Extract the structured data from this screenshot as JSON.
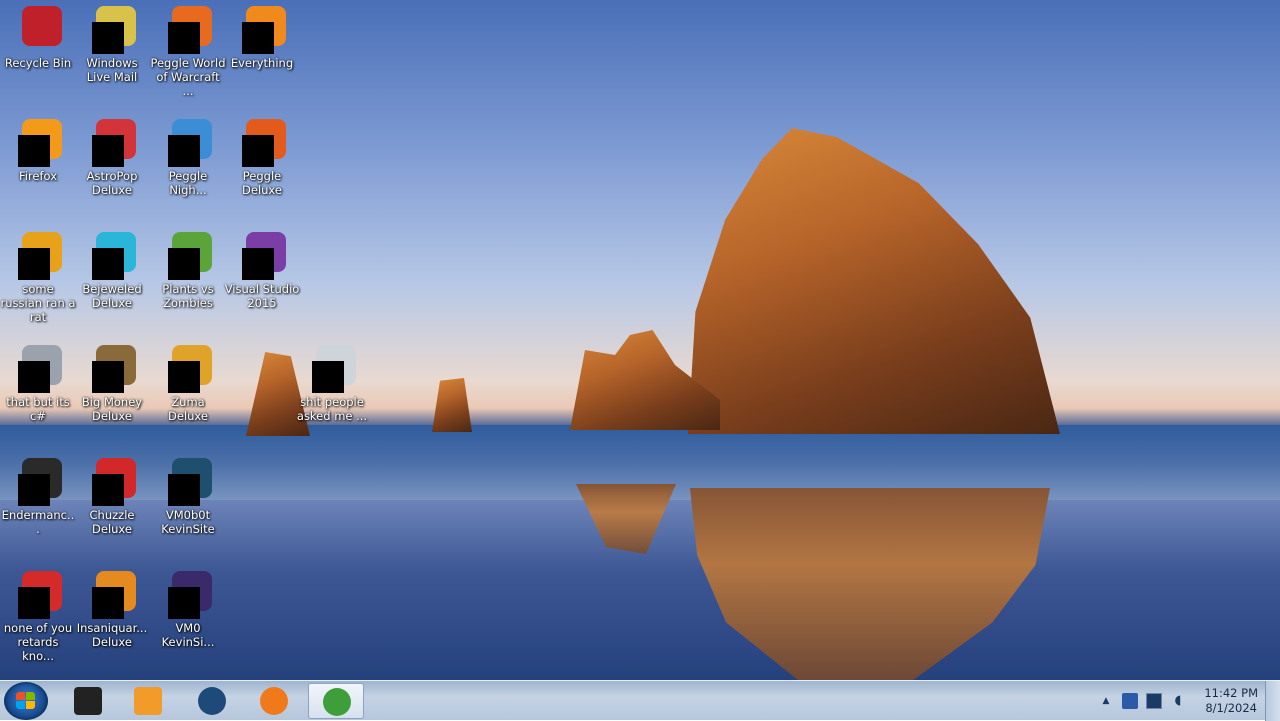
{
  "desktop": {
    "icons": [
      {
        "label": "Recycle Bin",
        "icon": "recycle-bin-icon",
        "color": "#c0202a"
      },
      {
        "label": "Windows Live Mail",
        "icon": "mail-icon",
        "color": "#d9c24a"
      },
      {
        "label": "Peggle World of Warcraft ...",
        "icon": "peggle-icon",
        "color": "#e76a1f"
      },
      {
        "label": "Everything",
        "icon": "search-icon",
        "color": "#f08a1c"
      },
      {
        "label": "Firefox",
        "icon": "firefox-icon",
        "color": "#f39a1b"
      },
      {
        "label": "AstroPop Deluxe",
        "icon": "astropop-icon",
        "color": "#d2343a"
      },
      {
        "label": "Peggle Nigh...",
        "icon": "peggle-nights-icon",
        "color": "#3b8ed6"
      },
      {
        "label": "Peggle Deluxe",
        "icon": "peggle-icon",
        "color": "#e25a1c"
      },
      {
        "label": "some russian ran a rat",
        "icon": "app-icon",
        "color": "#e8a21a"
      },
      {
        "label": "Bejeweled Deluxe",
        "icon": "bejeweled-icon",
        "color": "#29b6d8"
      },
      {
        "label": "Plants vs Zombies",
        "icon": "pvz-icon",
        "color": "#5aa43a"
      },
      {
        "label": "Visual Studio 2015",
        "icon": "visual-studio-icon",
        "color": "#7a3ea6"
      },
      {
        "label": "that but its c#",
        "icon": "shortcut-icon",
        "color": "#9aa2ad"
      },
      {
        "label": "Big Money Deluxe",
        "icon": "money-bag-icon",
        "color": "#8a6a3a"
      },
      {
        "label": "Zuma Deluxe",
        "icon": "zuma-icon",
        "color": "#e0a32a"
      },
      {
        "label": "shit people asked me ...",
        "icon": "file-icon",
        "color": "#cfd4da"
      },
      {
        "label": "Endermanc...",
        "icon": "terminal-icon",
        "color": "#2a2a2a"
      },
      {
        "label": "Chuzzle Deluxe",
        "icon": "chuzzle-icon",
        "color": "#d2282a"
      },
      {
        "label": "VM0b0t KevinSite",
        "icon": "vm-icon",
        "color": "#1e4f6e"
      },
      {
        "label": "none of you retards kno...",
        "icon": "app-icon",
        "color": "#d42a2a"
      },
      {
        "label": "Insaniquar... Deluxe",
        "icon": "insaniquarium-icon",
        "color": "#e58a1f"
      },
      {
        "label": "VM0 KevinSi...",
        "icon": "vm-icon",
        "color": "#3a2a6a"
      }
    ]
  },
  "taskbar": {
    "start": {
      "icon": "windows-start-icon"
    },
    "pinned": [
      {
        "icon": "terminal-icon",
        "color": "#222222",
        "active": false
      },
      {
        "icon": "media-player-icon",
        "color": "#f29b2a",
        "active": false
      },
      {
        "icon": "globe-icon",
        "color": "#1e4a7a",
        "active": false
      },
      {
        "icon": "firefox-icon",
        "color": "#f07a1a",
        "active": false
      },
      {
        "icon": "chrome-icon",
        "color": "#3e9e3a",
        "active": true
      }
    ],
    "tray": {
      "show_hidden": "▲",
      "clock_time": "11:42 PM",
      "clock_date": "8/1/2024"
    }
  }
}
